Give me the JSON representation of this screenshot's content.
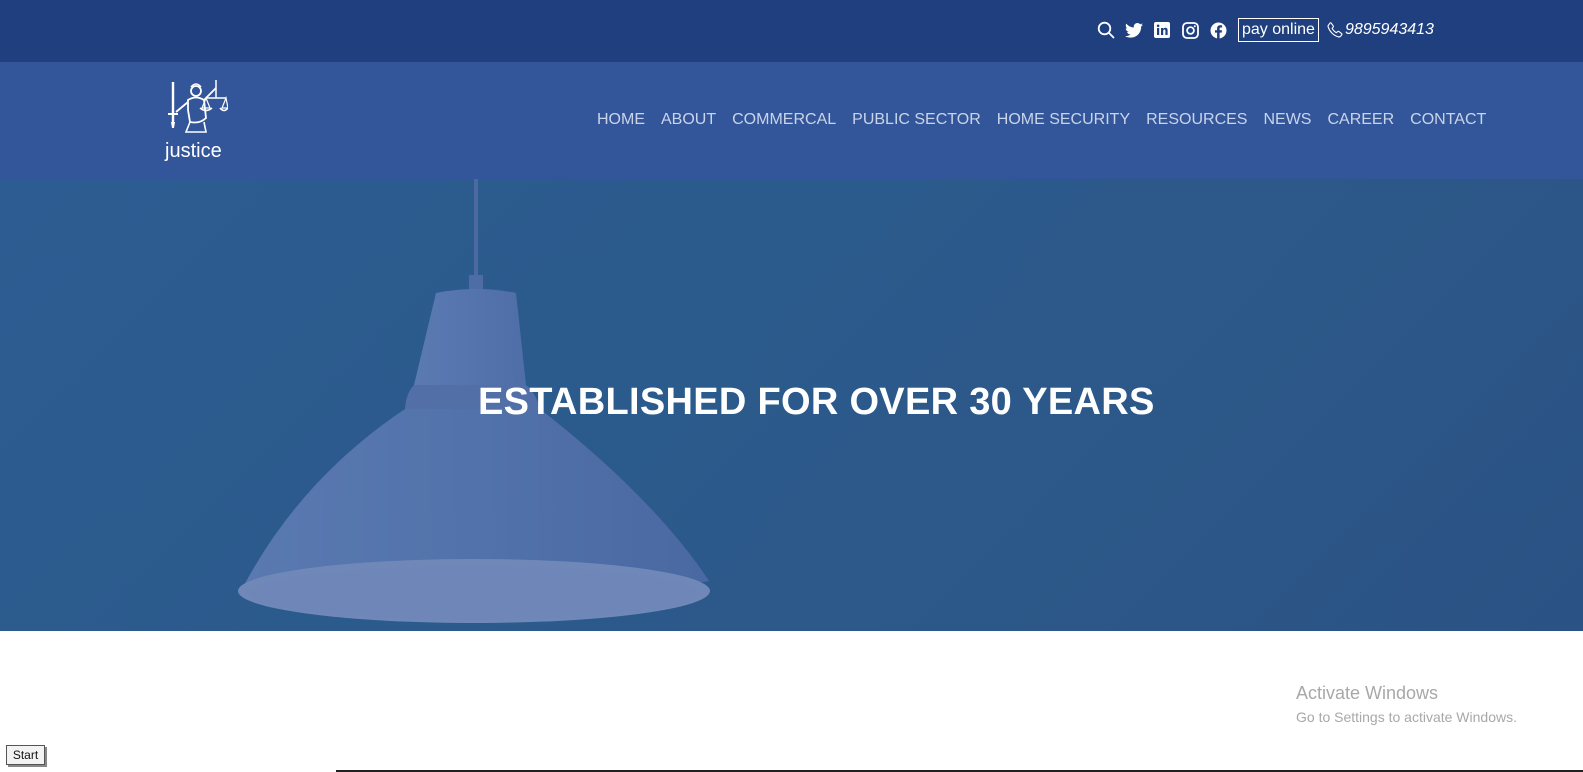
{
  "topbar": {
    "icons": [
      "search-icon",
      "twitter-icon",
      "linkedin-icon",
      "instagram-icon",
      "facebook-icon"
    ],
    "pay_online": "pay online",
    "phone": "9895943413",
    "bg_color": "#1f3f7e"
  },
  "header": {
    "logo_text": "justice",
    "bg_color": "#33569a",
    "nav": [
      "HOME",
      "ABOUT",
      "COMMERCAL",
      "PUBLIC SECTOR",
      "HOME SECURITY",
      "RESOURCES",
      "NEWS",
      "CAREER",
      "CONTACT"
    ]
  },
  "hero": {
    "title": "ESTABLISHED FOR OVER 30 YEARS"
  },
  "watermark": {
    "title": "Activate Windows",
    "subtitle": "Go to Settings to activate Windows."
  },
  "taskbar": {
    "start_label": "Start"
  }
}
